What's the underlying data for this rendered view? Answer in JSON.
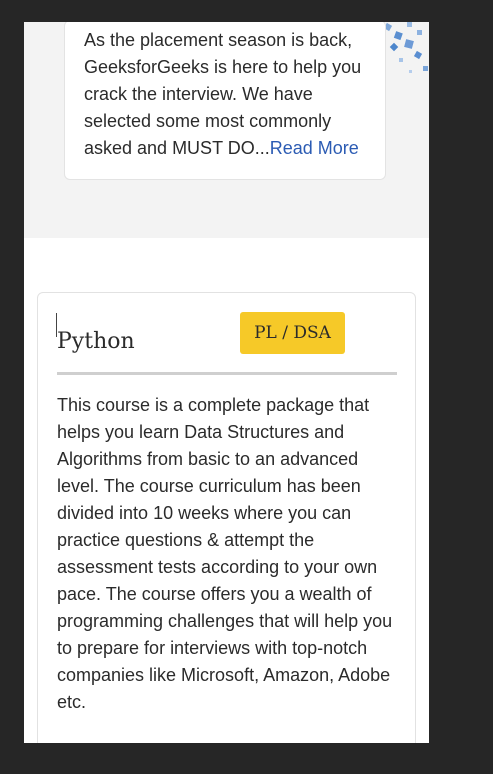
{
  "previous_card": {
    "text": "As the placement season is back, GeeksforGeeks is here to help you crack the interview. We have selected some most commonly asked and MUST DO...",
    "read_more": "Read More"
  },
  "course_card": {
    "title": "Python",
    "badge": "PL / DSA",
    "description": "This course is a complete package that helps you learn Data Structures and Algorithms from basic to an advanced level. The course curriculum has been divided into 10 weeks where you can practice questions & attempt the assessment tests according to your own pace. The course offers you a wealth of programming challenges that will help you to prepare for interviews with top-notch companies like Microsoft, Amazon, Adobe etc."
  },
  "colors": {
    "page_background": "#262626",
    "band_background": "#f3f3f3",
    "badge": "#f6c928",
    "link": "#2b5bb3"
  }
}
